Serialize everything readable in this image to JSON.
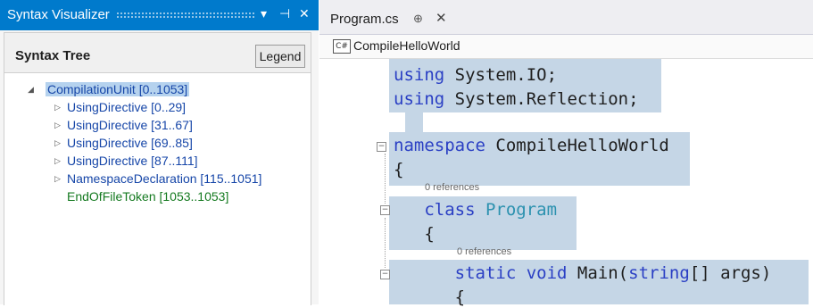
{
  "tool_window": {
    "title": "Syntax Visualizer",
    "dropdown_glyph": "▾",
    "pin_glyph": "⊣",
    "close_glyph": "✕",
    "tree_label": "Syntax Tree",
    "legend_button": "Legend",
    "nodes": [
      {
        "text": "CompilationUnit [0..1053]",
        "arrow": "◢"
      },
      {
        "text": "UsingDirective [0..29]",
        "arrow": "▷"
      },
      {
        "text": "UsingDirective [31..67]",
        "arrow": "▷"
      },
      {
        "text": "UsingDirective [69..85]",
        "arrow": "▷"
      },
      {
        "text": "UsingDirective [87..111]",
        "arrow": "▷"
      },
      {
        "text": "NamespaceDeclaration [115..1051]",
        "arrow": "▷"
      },
      {
        "text": "EndOfFileToken [1053..1053]",
        "arrow": ""
      }
    ]
  },
  "editor": {
    "tab_name": "Program.cs",
    "tab_pin": "⊕",
    "tab_close": "✕",
    "nav_icon": "C#",
    "nav_namespace": "CompileHelloWorld",
    "lines": {
      "l1_kw": "using",
      "l1_rest": " System.IO;",
      "l2_kw": "using",
      "l2_rest": " System.Reflection;",
      "l3_kw": "namespace",
      "l3_rest": " CompileHelloWorld",
      "l4": "{",
      "refs1": "0 references",
      "l5_kw": "class",
      "l5_type": " Program",
      "l6": "{",
      "refs2": "0 references",
      "l7_kw": "static void",
      "l7_rest": " Main(",
      "l7_kw2": "string",
      "l7_end": "[] args)",
      "l8": "{"
    },
    "fold_minus": "−"
  }
}
